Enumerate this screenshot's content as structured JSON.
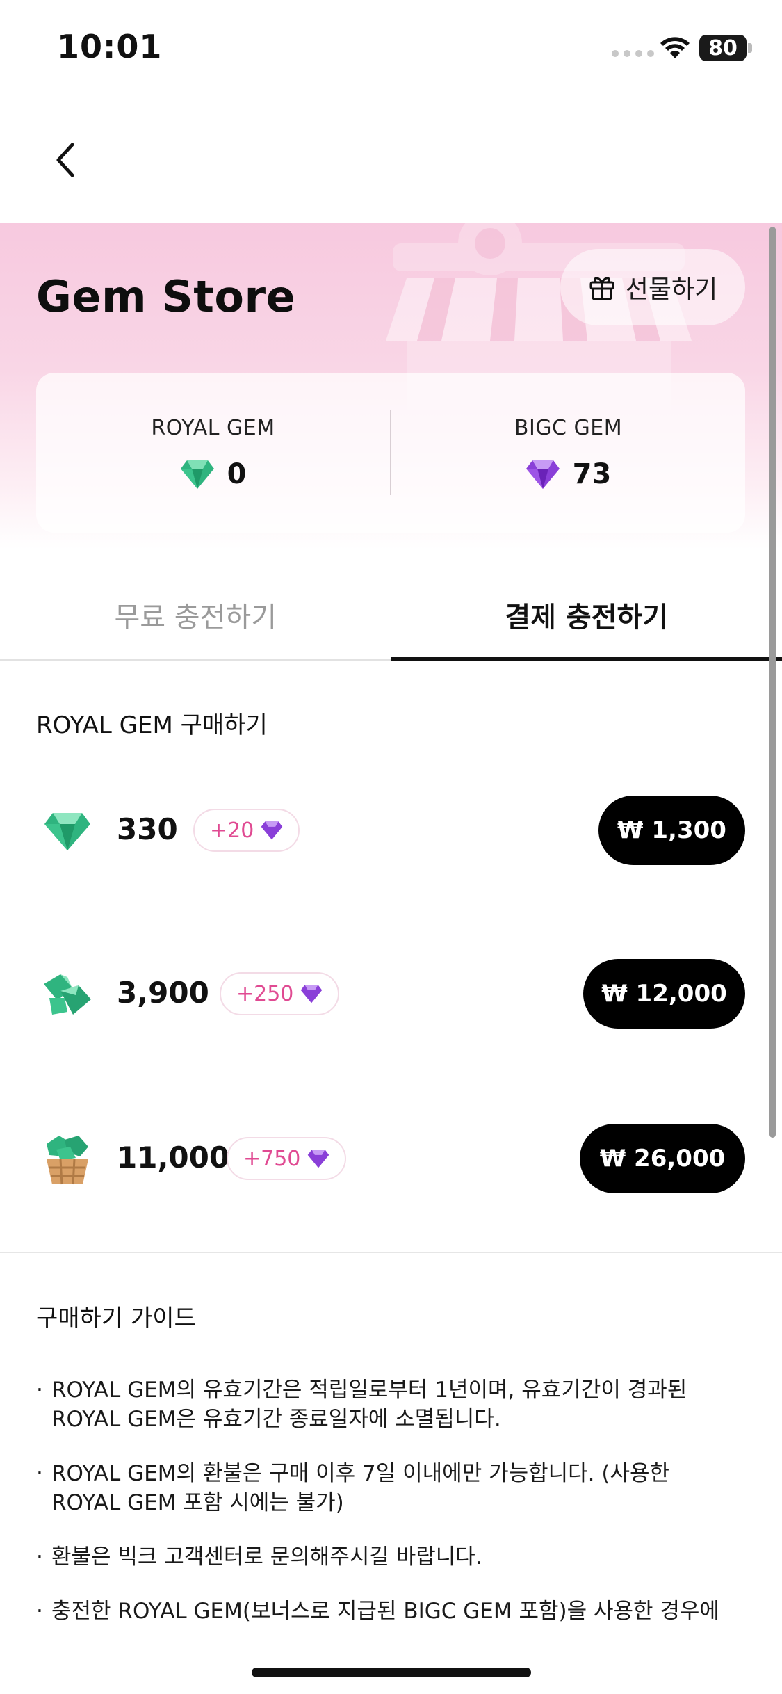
{
  "status_bar": {
    "time": "10:01",
    "battery": "80"
  },
  "header": {
    "title": "Gem Store",
    "gift_label": "선물하기"
  },
  "balances": [
    {
      "name": "ROYAL GEM",
      "value": "0",
      "icon": "green-gem-icon"
    },
    {
      "name": "BIGC GEM",
      "value": "73",
      "icon": "purple-gem-icon"
    }
  ],
  "tabs": [
    {
      "label": "무료 충전하기",
      "active": false
    },
    {
      "label": "결제 충전하기",
      "active": true
    }
  ],
  "purchase": {
    "section_title": "ROYAL GEM 구매하기",
    "products": [
      {
        "amount": "330",
        "bonus": "+20",
        "price": "₩ 1,300",
        "icon": "single-green-gem-icon"
      },
      {
        "amount": "3,900",
        "bonus": "+250",
        "price": "₩ 12,000",
        "icon": "gem-pile-icon"
      },
      {
        "amount": "11,000",
        "bonus": "+750",
        "price": "₩ 26,000",
        "icon": "gem-basket-icon"
      }
    ]
  },
  "guide": {
    "title": "구매하기 가이드",
    "items": [
      "ROYAL GEM의 유효기간은 적립일로부터 1년이며, 유효기간이 경과된 ROYAL GEM은 유효기간 종료일자에 소멸됩니다.",
      "ROYAL GEM의 환불은 구매 이후 7일 이내에만 가능합니다. (사용한 ROYAL GEM 포함 시에는 불가)",
      "환불은 빅크 고객센터로 문의해주시길 바랍니다.",
      "충전한 ROYAL GEM(보너스로 지급된 BIGC GEM 포함)을 사용한 경우에"
    ]
  },
  "colors": {
    "accent_pink": "#e04a92",
    "green_gem": "#2fb47f",
    "purple_gem": "#8a3fd8",
    "hero_pink": "#f7c9df"
  }
}
